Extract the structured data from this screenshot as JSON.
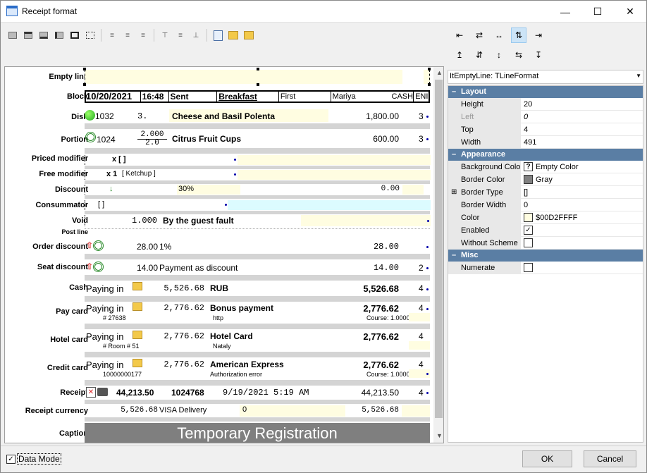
{
  "window": {
    "title": "Receipt format"
  },
  "toolbar": {
    "icons": [
      "border-none-icon",
      "border-top-icon",
      "border-bottom-icon",
      "border-left-icon",
      "border-full-icon",
      "border-dotted-icon",
      "align-left-icon",
      "align-center-icon",
      "align-right-icon",
      "valign-top-icon",
      "valign-middle-icon",
      "valign-bottom-icon",
      "preview-icon",
      "import-icon",
      "export-icon"
    ]
  },
  "labels": {
    "empty_line": "Empty line",
    "block": "Block",
    "dish": "Dish",
    "portion": "Portion",
    "priced_modifier": "Priced modifier",
    "free_modifier": "Free modifier",
    "discount": "Discount",
    "consummator": "Consummator",
    "void": "Void",
    "post_line": "Post line",
    "order_discount": "Order discount",
    "seat_discount": "Seat discount",
    "cash": "Cash",
    "pay_card": "Pay card",
    "hotel_card": "Hotel card",
    "credit_card": "Credit card",
    "receipt": "Receipt",
    "receipt_currency": "Receipt currency",
    "caption": "Caption"
  },
  "block": {
    "date": "10/20/2021",
    "time": "16:48",
    "status": "Sent",
    "meal": "Breakfast",
    "first": "First",
    "name": "Mariya",
    "cash": "CASH",
    "end": "ENI"
  },
  "dish": {
    "code": "1032",
    "qty": "3.",
    "name": "Cheese and Basil Polenta",
    "price": "1,800.00",
    "count": "3"
  },
  "portion": {
    "code": "1024",
    "num": "2.000",
    "den": "2.0",
    "name": "Citrus Fruit Cups",
    "price": "600.00",
    "count": "3"
  },
  "priced_modifier": {
    "text": "x [ ]"
  },
  "free_modifier": {
    "text": "x 1",
    "bracket": "[ Ketchup ]"
  },
  "discount": {
    "pct": "30%",
    "amount": "0.00"
  },
  "consummator": {
    "text": "[ ]"
  },
  "void": {
    "qty": "1.000",
    "reason": "By the guest fault"
  },
  "order_discount": {
    "amount": "28.00",
    "pct": "1%",
    "total": "28.00"
  },
  "seat_discount": {
    "amount": "14.00",
    "desc": "Payment as discount",
    "total": "14.00",
    "count": "2"
  },
  "cash": {
    "paying": "Paying in",
    "amount": "5,526.68",
    "currency": "RUB",
    "total": "5,526.68",
    "count": "4"
  },
  "pay_card": {
    "paying": "Paying in",
    "amount": "2,776.62",
    "name": "Bonus payment",
    "total": "2,776.62",
    "count": "4",
    "num": "# 27638",
    "url": "http",
    "course": "Course: 1.0000"
  },
  "hotel_card": {
    "paying": "Paying in",
    "amount": "2,776.62",
    "name": "Hotel Card",
    "total": "2,776.62",
    "count": "4",
    "room": "# Room # 51",
    "guest": "Nataly"
  },
  "credit_card": {
    "paying": "Paying in",
    "amount": "2,776.62",
    "name": "American Express",
    "total": "2,776.62",
    "count": "4",
    "num": "10000000177",
    "error": "Authorization error",
    "course": "Course: 1.0000"
  },
  "receipt": {
    "total": "44,213.50",
    "num": "1024768",
    "date": "9/19/2021 5:19 AM",
    "sum": "44,213.50",
    "count": "4"
  },
  "receipt_currency": {
    "amount": "5,526.68",
    "name": "VISA Delivery",
    "zero": "0",
    "total": "5,526.68"
  },
  "caption": {
    "text": "Temporary Registration"
  },
  "inspector": {
    "object": "ItEmptyLine: TLineFormat",
    "layout_label": "Layout",
    "height_label": "Height",
    "height": "20",
    "left_label": "Left",
    "left": "0",
    "top_label": "Top",
    "top": "4",
    "width_label": "Width",
    "width": "491",
    "appearance_label": "Appearance",
    "bg_label": "Background Colo",
    "bg_value": "Empty Color",
    "border_color_label": "Border Color",
    "border_color_value": "Gray",
    "border_type_label": "Border Type",
    "border_type_value": "[]",
    "border_width_label": "Border Width",
    "border_width_value": "0",
    "color_label": "Color",
    "color_value": "$00D2FFFF",
    "enabled_label": "Enabled",
    "without_scheme_label": "Without Scheme",
    "misc_label": "Misc",
    "numerate_label": "Numerate"
  },
  "footer": {
    "data_mode": "Data Mode",
    "ok": "OK",
    "cancel": "Cancel"
  },
  "colors": {
    "accent": "#5a7ea4",
    "yellow": "#fffde1",
    "caption_bg": "#7f7f7f"
  }
}
